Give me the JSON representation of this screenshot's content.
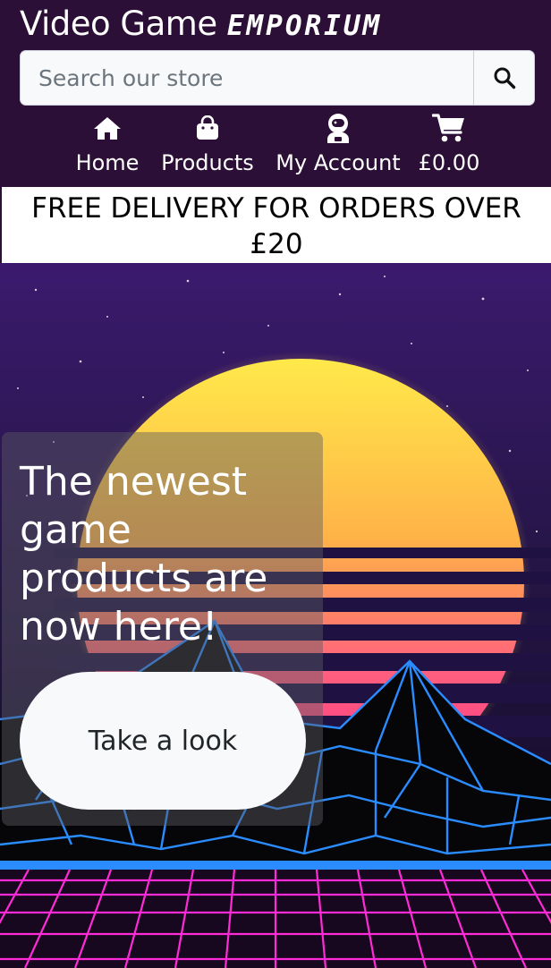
{
  "brand": {
    "first": "Video Game",
    "second": "Emporium"
  },
  "search": {
    "placeholder": "Search our store",
    "icon": "search-icon"
  },
  "nav": {
    "home": {
      "label": "Home",
      "icon": "home-icon"
    },
    "products": {
      "label": "Products",
      "icon": "shopping-bag-icon"
    },
    "account": {
      "label": "My Account",
      "icon": "user-astronaut-icon"
    },
    "cart": {
      "label": "£0.00",
      "icon": "cart-icon"
    }
  },
  "banner": {
    "text": "FREE DELIVERY FOR ORDERS OVER £20"
  },
  "hero": {
    "title": "The newest game products are now here!",
    "button_label": "Take a look"
  },
  "colors": {
    "header_bg": "#2c0f36",
    "banner_bg": "#ffffff",
    "grid_pink": "#ff2bd6",
    "grid_blue": "#2a8cff",
    "sun_top": "#ffe94a",
    "sun_bottom": "#ff2e8a"
  }
}
